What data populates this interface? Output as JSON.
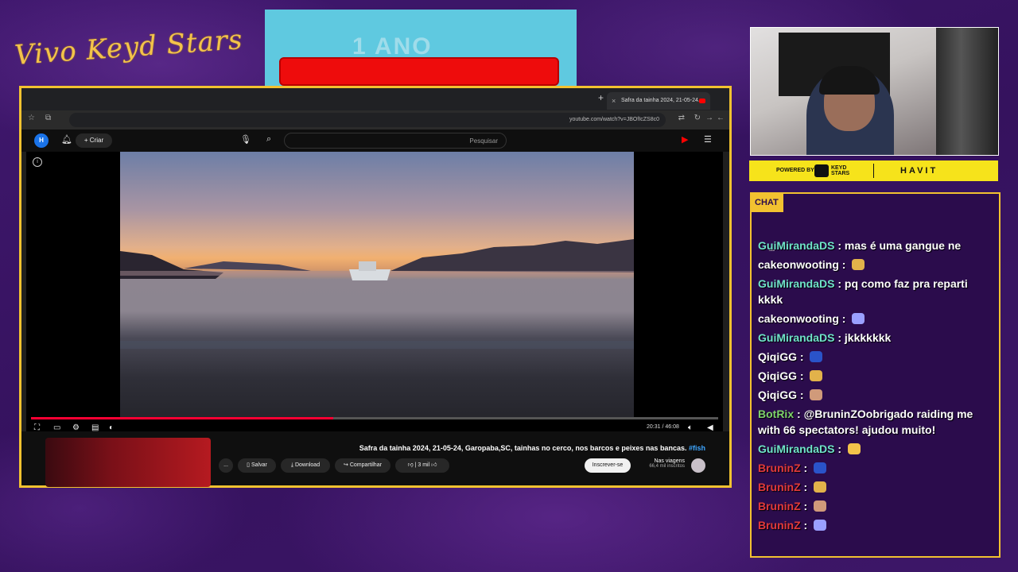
{
  "overlay": {
    "brand_script": "Vivo Keyd Stars",
    "banner_text": "1 ANO",
    "sponsor": {
      "powered_by": "POWERED BY",
      "keyd": "KEYD\nSTARS",
      "havit": "HAVIT"
    }
  },
  "browser": {
    "tab_title": "Safra da tainha 2024, 21-05-24...",
    "url": "youtube.com/watch?v=JBOfIcZS8c0"
  },
  "youtube": {
    "search_placeholder": "Pesquisar",
    "create_label": "Criar",
    "avatar_letter": "H",
    "time": "20:31 / 46:08",
    "video_title": "Safra da tainha 2024, 21-05-24, Garopaba,SC, tainhas no cerco, nos barcos e peixes nas bancas.",
    "video_tag": "#fish",
    "channel_name": "Nas viagens",
    "channel_subs": "66,4 mil inscritos",
    "subscribe": "Inscrever-se",
    "likes": "3 mil",
    "share": "Compartilhar",
    "download": "Download",
    "save": "Salvar",
    "more": "..."
  },
  "chat": {
    "header": "CHAT",
    "messages": [
      {
        "user": "GuiMirandaDS",
        "text": "mas é uma gangue ne",
        "color": "#6fe3c9"
      },
      {
        "user": "cakeonwooting",
        "text": "",
        "color": "#ffffff"
      },
      {
        "user": "GuiMirandaDS",
        "text": "pq como faz pra reparti kkkk",
        "color": "#6fe3c9"
      },
      {
        "user": "cakeonwooting",
        "text": "",
        "color": "#ffffff"
      },
      {
        "user": "GuiMirandaDS",
        "text": "jkkkkkkk",
        "color": "#6fe3c9"
      },
      {
        "user": "QiqiGG",
        "text": "",
        "color": "#ffffff"
      },
      {
        "user": "QiqiGG",
        "text": "",
        "color": "#ffffff"
      },
      {
        "user": "QiqiGG",
        "text": "",
        "color": "#ffffff"
      },
      {
        "user": "BotRix",
        "text": "@BruninZOobrigado raiding me with 66 spectators! ajudou muito!",
        "color": "#7ed36a"
      },
      {
        "user": "GuiMirandaDS",
        "text": "",
        "color": "#6fe3c9"
      },
      {
        "user": "BruninZ",
        "text": "",
        "color": "#e23a3a"
      },
      {
        "user": "BruninZ",
        "text": "",
        "color": "#e23a3a"
      },
      {
        "user": "BruninZ",
        "text": "",
        "color": "#e23a3a"
      },
      {
        "user": "BruninZ",
        "text": "",
        "color": "#e23a3a"
      }
    ]
  },
  "colors": {
    "frame_accent": "#f2c230",
    "background": "#3b1466",
    "banner_bar": "#ee0c0c",
    "sponsor_bg": "#f6e31b"
  },
  "video_progress_fraction": 0.44
}
